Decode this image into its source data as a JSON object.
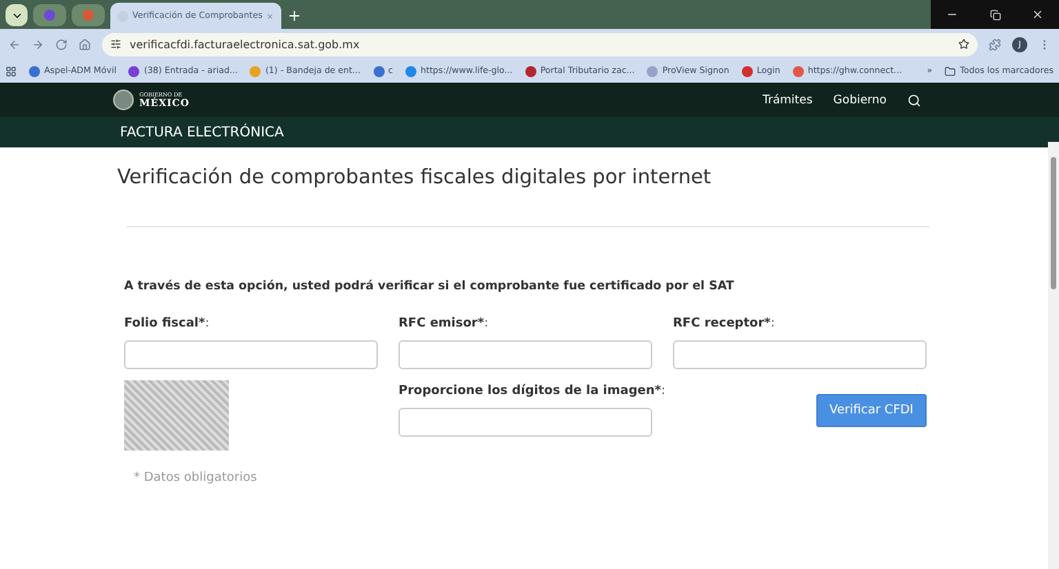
{
  "browser": {
    "tab": {
      "title": "Verificación de Comprobantes",
      "selected": true
    },
    "url": "verificacfdi.facturaelectronica.sat.gob.mx",
    "bookmarks": [
      {
        "label": "Aspel-ADM Móvil",
        "color": "#3b6fd1"
      },
      {
        "label": "(38) Entrada - ariad...",
        "color": "#7a3fd6"
      },
      {
        "label": "(1) - Bandeja de ent...",
        "color": "#e8a321"
      },
      {
        "label": "c",
        "color": "#3b6fd1"
      },
      {
        "label": "https://www.life-glo...",
        "color": "#1e88e5"
      },
      {
        "label": "Portal Tributario zac...",
        "color": "#b3262f"
      },
      {
        "label": "ProView Signon",
        "color": "#9aa0c9"
      },
      {
        "label": "Login",
        "color": "#d32f2f"
      },
      {
        "label": "https://ghw.connect...",
        "color": "#e0584a"
      }
    ],
    "more_chevron": "»",
    "all_bookmarks": "Todos los marcadores",
    "profile_initial": "J"
  },
  "gov_header": {
    "logo_top": "GOBIERNO DE",
    "logo_bottom": "MÉXICO",
    "nav": [
      "Trámites",
      "Gobierno"
    ]
  },
  "section_bar": {
    "title": "FACTURA ELECTRÓNICA"
  },
  "page": {
    "title": "Verificación de comprobantes fiscales digitales por internet",
    "intro": "A través de esta opción, usted podrá verificar si el comprobante fue certificado por el SAT",
    "fields": [
      {
        "label": "Folio fiscal*",
        "colon": ":"
      },
      {
        "label": "RFC emisor*",
        "colon": ":"
      },
      {
        "label": "RFC receptor*",
        "colon": ":"
      }
    ],
    "captcha_field": {
      "label": "Proporcione los dígitos de la imagen*",
      "colon": ":"
    },
    "submit": "Verificar CFDI",
    "note": "* Datos obligatorios"
  }
}
